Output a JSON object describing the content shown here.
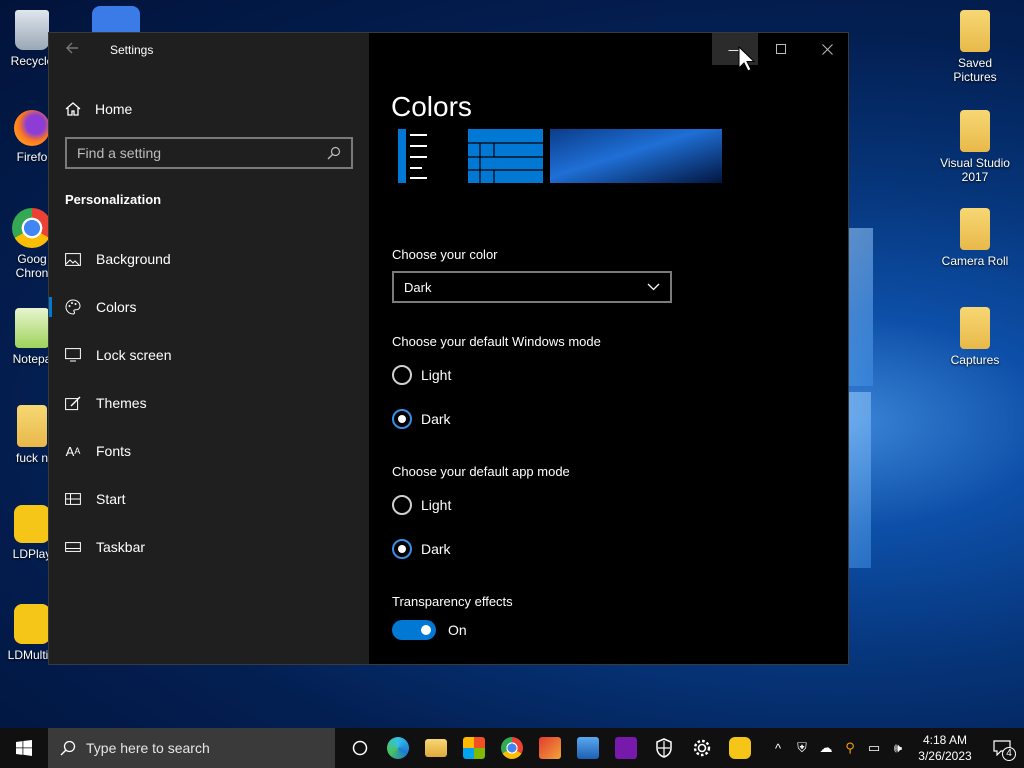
{
  "desktop": {
    "left_icons": [
      {
        "label": "Recycle",
        "icon": "recycle-bin-icon"
      },
      {
        "label": "Firefo",
        "icon": "firefox-icon"
      },
      {
        "label": "Goog\nChron",
        "icon": "chrome-icon"
      },
      {
        "label": "Notepa",
        "icon": "notepad-icon"
      },
      {
        "label": "fuck n",
        "icon": "zip-folder-icon"
      },
      {
        "label": "LDPlay",
        "icon": "ldplayer-icon"
      },
      {
        "label": "LDMultiP",
        "icon": "ldmultiplayer-icon"
      }
    ],
    "right_icons": [
      {
        "label": "Saved Pictures",
        "icon": "folder-icon"
      },
      {
        "label": "Visual Studio 2017",
        "icon": "folder-icon"
      },
      {
        "label": "Camera Roll",
        "icon": "folder-icon"
      },
      {
        "label": "Captures",
        "icon": "folder-icon"
      }
    ]
  },
  "window": {
    "title": "Settings",
    "home_label": "Home",
    "search": {
      "placeholder": "Find a setting"
    },
    "section": "Personalization",
    "nav_items": [
      {
        "label": "Background",
        "icon": "image-icon"
      },
      {
        "label": "Colors",
        "icon": "palette-icon"
      },
      {
        "label": "Lock screen",
        "icon": "monitor-icon"
      },
      {
        "label": "Themes",
        "icon": "brush-icon"
      },
      {
        "label": "Fonts",
        "icon": "font-icon"
      },
      {
        "label": "Start",
        "icon": "start-grid-icon"
      },
      {
        "label": "Taskbar",
        "icon": "taskbar-icon"
      }
    ],
    "active_nav": "Colors"
  },
  "content": {
    "title": "Colors",
    "choose_color_label": "Choose your color",
    "choose_color_value": "Dark",
    "windows_mode_label": "Choose your default Windows mode",
    "windows_mode_options": [
      "Light",
      "Dark"
    ],
    "windows_mode_selected": "Dark",
    "app_mode_label": "Choose your default app mode",
    "app_mode_options": [
      "Light",
      "Dark"
    ],
    "app_mode_selected": "Dark",
    "transparency_label": "Transparency effects",
    "transparency_state": "On"
  },
  "taskbar": {
    "search_placeholder": "Type here to search",
    "apps": [
      "task-view-icon",
      "edge-icon",
      "file-explorer-icon",
      "store-icon",
      "chrome-icon",
      "game-icon",
      "photos-icon",
      "onenote-icon",
      "security-icon",
      "settings-icon",
      "ldplayer-icon"
    ],
    "time": "4:18 AM",
    "date": "3/26/2023",
    "notification_count": "4"
  },
  "colors": {
    "accent": "#0078d4",
    "nav_bg": "#1f1f1f",
    "content_bg": "#000000"
  }
}
